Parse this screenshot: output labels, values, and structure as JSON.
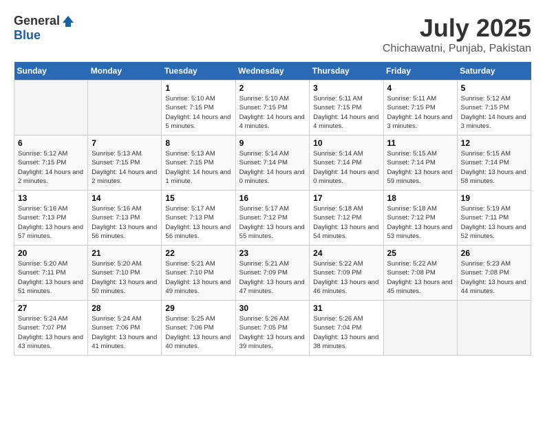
{
  "logo": {
    "general": "General",
    "blue": "Blue"
  },
  "header": {
    "month": "July 2025",
    "location": "Chichawatni, Punjab, Pakistan"
  },
  "days_of_week": [
    "Sunday",
    "Monday",
    "Tuesday",
    "Wednesday",
    "Thursday",
    "Friday",
    "Saturday"
  ],
  "weeks": [
    [
      {
        "day": "",
        "info": ""
      },
      {
        "day": "",
        "info": ""
      },
      {
        "day": "1",
        "info": "Sunrise: 5:10 AM\nSunset: 7:15 PM\nDaylight: 14 hours and 5 minutes."
      },
      {
        "day": "2",
        "info": "Sunrise: 5:10 AM\nSunset: 7:15 PM\nDaylight: 14 hours and 4 minutes."
      },
      {
        "day": "3",
        "info": "Sunrise: 5:11 AM\nSunset: 7:15 PM\nDaylight: 14 hours and 4 minutes."
      },
      {
        "day": "4",
        "info": "Sunrise: 5:11 AM\nSunset: 7:15 PM\nDaylight: 14 hours and 3 minutes."
      },
      {
        "day": "5",
        "info": "Sunrise: 5:12 AM\nSunset: 7:15 PM\nDaylight: 14 hours and 3 minutes."
      }
    ],
    [
      {
        "day": "6",
        "info": "Sunrise: 5:12 AM\nSunset: 7:15 PM\nDaylight: 14 hours and 2 minutes."
      },
      {
        "day": "7",
        "info": "Sunrise: 5:13 AM\nSunset: 7:15 PM\nDaylight: 14 hours and 2 minutes."
      },
      {
        "day": "8",
        "info": "Sunrise: 5:13 AM\nSunset: 7:15 PM\nDaylight: 14 hours and 1 minute."
      },
      {
        "day": "9",
        "info": "Sunrise: 5:14 AM\nSunset: 7:14 PM\nDaylight: 14 hours and 0 minutes."
      },
      {
        "day": "10",
        "info": "Sunrise: 5:14 AM\nSunset: 7:14 PM\nDaylight: 14 hours and 0 minutes."
      },
      {
        "day": "11",
        "info": "Sunrise: 5:15 AM\nSunset: 7:14 PM\nDaylight: 13 hours and 59 minutes."
      },
      {
        "day": "12",
        "info": "Sunrise: 5:15 AM\nSunset: 7:14 PM\nDaylight: 13 hours and 58 minutes."
      }
    ],
    [
      {
        "day": "13",
        "info": "Sunrise: 5:16 AM\nSunset: 7:13 PM\nDaylight: 13 hours and 57 minutes."
      },
      {
        "day": "14",
        "info": "Sunrise: 5:16 AM\nSunset: 7:13 PM\nDaylight: 13 hours and 56 minutes."
      },
      {
        "day": "15",
        "info": "Sunrise: 5:17 AM\nSunset: 7:13 PM\nDaylight: 13 hours and 56 minutes."
      },
      {
        "day": "16",
        "info": "Sunrise: 5:17 AM\nSunset: 7:12 PM\nDaylight: 13 hours and 55 minutes."
      },
      {
        "day": "17",
        "info": "Sunrise: 5:18 AM\nSunset: 7:12 PM\nDaylight: 13 hours and 54 minutes."
      },
      {
        "day": "18",
        "info": "Sunrise: 5:18 AM\nSunset: 7:12 PM\nDaylight: 13 hours and 53 minutes."
      },
      {
        "day": "19",
        "info": "Sunrise: 5:19 AM\nSunset: 7:11 PM\nDaylight: 13 hours and 52 minutes."
      }
    ],
    [
      {
        "day": "20",
        "info": "Sunrise: 5:20 AM\nSunset: 7:11 PM\nDaylight: 13 hours and 51 minutes."
      },
      {
        "day": "21",
        "info": "Sunrise: 5:20 AM\nSunset: 7:10 PM\nDaylight: 13 hours and 50 minutes."
      },
      {
        "day": "22",
        "info": "Sunrise: 5:21 AM\nSunset: 7:10 PM\nDaylight: 13 hours and 49 minutes."
      },
      {
        "day": "23",
        "info": "Sunrise: 5:21 AM\nSunset: 7:09 PM\nDaylight: 13 hours and 47 minutes."
      },
      {
        "day": "24",
        "info": "Sunrise: 5:22 AM\nSunset: 7:09 PM\nDaylight: 13 hours and 46 minutes."
      },
      {
        "day": "25",
        "info": "Sunrise: 5:22 AM\nSunset: 7:08 PM\nDaylight: 13 hours and 45 minutes."
      },
      {
        "day": "26",
        "info": "Sunrise: 5:23 AM\nSunset: 7:08 PM\nDaylight: 13 hours and 44 minutes."
      }
    ],
    [
      {
        "day": "27",
        "info": "Sunrise: 5:24 AM\nSunset: 7:07 PM\nDaylight: 13 hours and 43 minutes."
      },
      {
        "day": "28",
        "info": "Sunrise: 5:24 AM\nSunset: 7:06 PM\nDaylight: 13 hours and 41 minutes."
      },
      {
        "day": "29",
        "info": "Sunrise: 5:25 AM\nSunset: 7:06 PM\nDaylight: 13 hours and 40 minutes."
      },
      {
        "day": "30",
        "info": "Sunrise: 5:26 AM\nSunset: 7:05 PM\nDaylight: 13 hours and 39 minutes."
      },
      {
        "day": "31",
        "info": "Sunrise: 5:26 AM\nSunset: 7:04 PM\nDaylight: 13 hours and 38 minutes."
      },
      {
        "day": "",
        "info": ""
      },
      {
        "day": "",
        "info": ""
      }
    ]
  ]
}
